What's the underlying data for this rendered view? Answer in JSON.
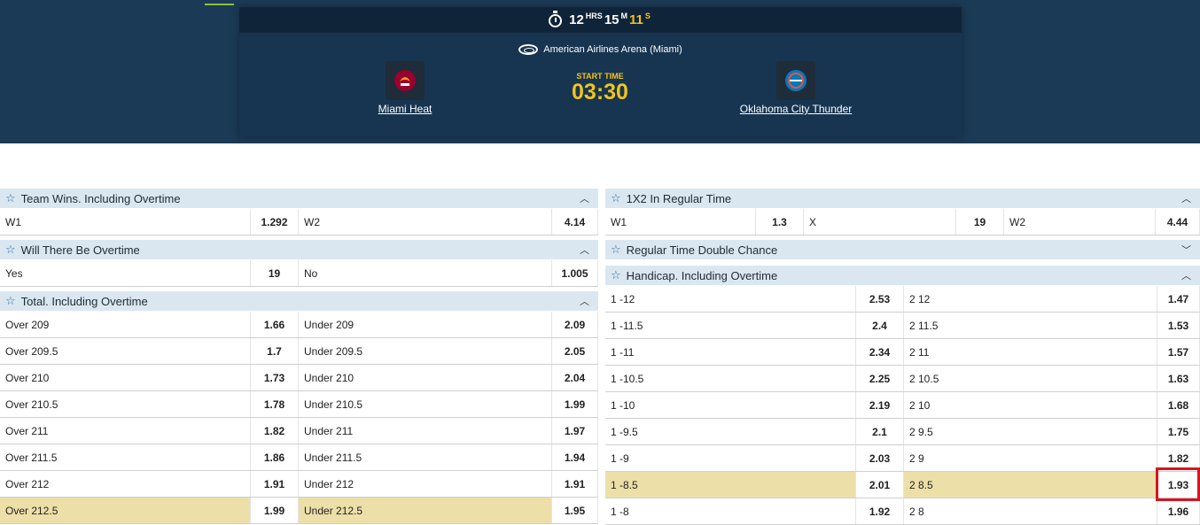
{
  "timer": {
    "hours": "12",
    "hours_unit": "HRS",
    "minutes": "15",
    "minutes_unit": "M",
    "seconds": "11",
    "seconds_unit": "S"
  },
  "event": {
    "arena": "American Airlines Arena (Miami)",
    "start_label": "START TIME",
    "start_time": "03:30",
    "home": "Miami Heat",
    "away": "Oklahoma City Thunder"
  },
  "colors": {
    "hero_bg": "#1b3a55",
    "accent_yellow": "#f1c31c",
    "header_bg": "#dbe7f0",
    "highlight": "#ecdfa8",
    "focus_box": "#d7141f"
  },
  "left": {
    "team_wins": {
      "title": "Team Wins. Including Overtime",
      "w1": "W1",
      "w1_odd": "1.292",
      "w2": "W2",
      "w2_odd": "4.14"
    },
    "overtime": {
      "title": "Will There Be Overtime",
      "yes": "Yes",
      "yes_odd": "19",
      "no": "No",
      "no_odd": "1.005"
    },
    "total": {
      "title": "Total. Including Overtime",
      "rows": [
        {
          "over": "Over 209",
          "over_odd": "1.66",
          "under": "Under 209",
          "under_odd": "2.09"
        },
        {
          "over": "Over 209.5",
          "over_odd": "1.7",
          "under": "Under 209.5",
          "under_odd": "2.05"
        },
        {
          "over": "Over 210",
          "over_odd": "1.73",
          "under": "Under 210",
          "under_odd": "2.04"
        },
        {
          "over": "Over 210.5",
          "over_odd": "1.78",
          "under": "Under 210.5",
          "under_odd": "1.99"
        },
        {
          "over": "Over 211",
          "over_odd": "1.82",
          "under": "Under 211",
          "under_odd": "1.97"
        },
        {
          "over": "Over 211.5",
          "over_odd": "1.86",
          "under": "Under 211.5",
          "under_odd": "1.94"
        },
        {
          "over": "Over 212",
          "over_odd": "1.91",
          "under": "Under 212",
          "under_odd": "1.91"
        },
        {
          "over": "Over 212.5",
          "over_odd": "1.99",
          "under": "Under 212.5",
          "under_odd": "1.95"
        }
      ]
    }
  },
  "right": {
    "x12": {
      "title": "1X2 In Regular Time",
      "w1": "W1",
      "w1_odd": "1.3",
      "x": "X",
      "x_odd": "19",
      "w2": "W2",
      "w2_odd": "4.44"
    },
    "double_chance": {
      "title": "Regular Time Double Chance"
    },
    "handicap": {
      "title": "Handicap. Including Overtime",
      "rows": [
        {
          "h1": "1 -12",
          "h1_odd": "2.53",
          "h2": "2 12",
          "h2_odd": "1.47"
        },
        {
          "h1": "1 -11.5",
          "h1_odd": "2.4",
          "h2": "2 11.5",
          "h2_odd": "1.53"
        },
        {
          "h1": "1 -11",
          "h1_odd": "2.34",
          "h2": "2 11",
          "h2_odd": "1.57"
        },
        {
          "h1": "1 -10.5",
          "h1_odd": "2.25",
          "h2": "2 10.5",
          "h2_odd": "1.63"
        },
        {
          "h1": "1 -10",
          "h1_odd": "2.19",
          "h2": "2 10",
          "h2_odd": "1.68"
        },
        {
          "h1": "1 -9.5",
          "h1_odd": "2.1",
          "h2": "2 9.5",
          "h2_odd": "1.75"
        },
        {
          "h1": "1 -9",
          "h1_odd": "2.03",
          "h2": "2 9",
          "h2_odd": "1.82"
        },
        {
          "h1": "1 -8.5",
          "h1_odd": "2.01",
          "h2": "2 8.5",
          "h2_odd": "1.93"
        },
        {
          "h1": "1 -8",
          "h1_odd": "1.92",
          "h2": "2 8",
          "h2_odd": "1.96"
        }
      ]
    }
  }
}
